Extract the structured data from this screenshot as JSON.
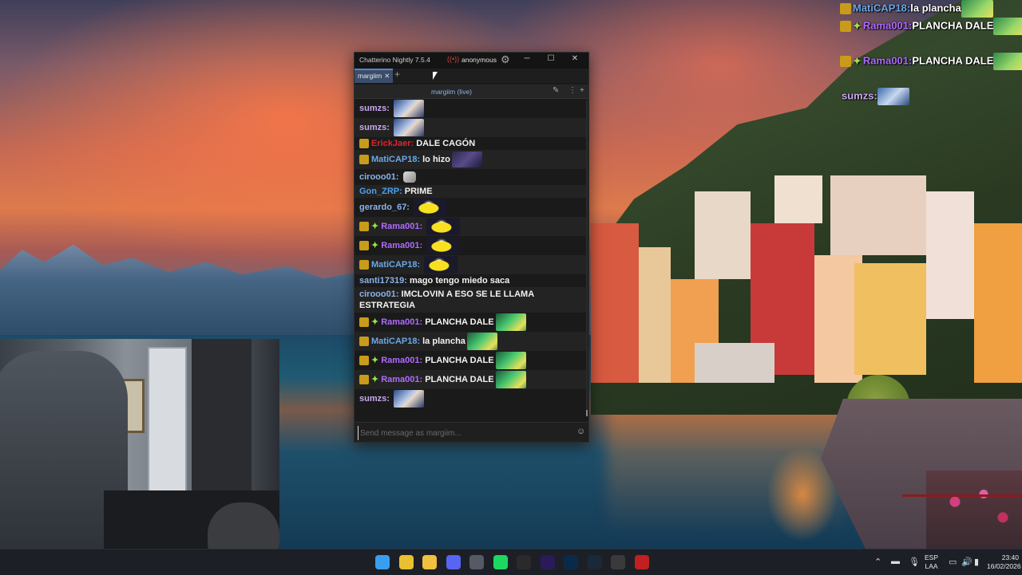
{
  "window": {
    "title": "Chatterino Nightly 7.5.4",
    "user": "anonymous",
    "minimize": "─",
    "maximize": "☐",
    "close": "✕"
  },
  "tabs": [
    {
      "label": "margiim"
    }
  ],
  "channel_header": "margiim (live)",
  "messages": [
    {
      "nick": "sumzs:",
      "color": "#c8a8f0",
      "text": "",
      "emote": "e-face"
    },
    {
      "nick": "sumzs:",
      "color": "#c8a8f0",
      "text": "",
      "emote": "e-face"
    },
    {
      "nick": "ErickJaer:",
      "color": "#e0242e",
      "text": "DALE CAGÓN",
      "badge": true
    },
    {
      "nick": "MatiCAP18:",
      "color": "#6aa8e8",
      "text": "lo hizo",
      "badge": true,
      "emote": "e-lo"
    },
    {
      "nick": "cirooo01:",
      "color": "#8ab4e8",
      "text": "",
      "emote": "e-hands"
    },
    {
      "nick": "Gon_ZRP:",
      "color": "#4aa0f0",
      "text": "PRIME"
    },
    {
      "nick": "gerardo_67:",
      "color": "#8ab4e8",
      "text": "",
      "emote": "e-minion"
    },
    {
      "nick": "Rama001:",
      "color": "#b06aff",
      "text": "",
      "badge": true,
      "spark": true,
      "emote": "e-minion"
    },
    {
      "nick": "Rama001:",
      "color": "#b06aff",
      "text": "",
      "badge": true,
      "spark": true,
      "emote": "e-minion"
    },
    {
      "nick": "MatiCAP18:",
      "color": "#6aa8e8",
      "text": "",
      "badge": true,
      "emote": "e-minion"
    },
    {
      "nick": "santi17319:",
      "color": "#8ab4e8",
      "text": "mago tengo miedo saca"
    },
    {
      "nick": "cirooo01:",
      "color": "#8ab4e8",
      "text": "IMCLOVIN A ESO SE LE LLAMA ESTRATEGIA"
    },
    {
      "nick": "Rama001:",
      "color": "#b06aff",
      "text": "PLANCHA DALE",
      "badge": true,
      "spark": true,
      "emote": "e-green"
    },
    {
      "nick": "MatiCAP18:",
      "color": "#6aa8e8",
      "text": "la plancha",
      "badge": true,
      "emote": "e-green"
    },
    {
      "nick": "Rama001:",
      "color": "#b06aff",
      "text": "PLANCHA DALE",
      "badge": true,
      "spark": true,
      "emote": "e-green"
    },
    {
      "nick": "Rama001:",
      "color": "#b06aff",
      "text": "PLANCHA DALE",
      "badge": true,
      "spark": true,
      "emote": "e-green"
    },
    {
      "nick": "sumzs:",
      "color": "#c8a8f0",
      "text": "",
      "emote": "e-face"
    }
  ],
  "input": {
    "placeholder": "Send message as margiim..."
  },
  "overlay": [
    {
      "nick": "MatiCAP18:",
      "color": "#6aa8e8",
      "text": "la plancha",
      "spark": false,
      "emote": "green"
    },
    {
      "nick": "Rama001:",
      "color": "#b06aff",
      "text": "PLANCHA DALE",
      "spark": true,
      "emote": "green"
    },
    {
      "nick": "Rama001:",
      "color": "#b06aff",
      "text": "PLANCHA DALE",
      "spark": true,
      "emote": "green"
    },
    {
      "nick": "sumzs:",
      "color": "#c8a8f0",
      "text": "",
      "spark": false,
      "emote": "face",
      "nobadge": true
    }
  ],
  "taskbar": {
    "language_top": "ESP",
    "language_bottom": "LAA",
    "time": "23:40",
    "date": "16/02/2026",
    "apps": [
      {
        "name": "windows-start-icon",
        "color": "#3a9ef0"
      },
      {
        "name": "chrome-icon",
        "color": "#e8c030"
      },
      {
        "name": "file-explorer-icon",
        "color": "#f0c040"
      },
      {
        "name": "discord-icon",
        "color": "#5865f2"
      },
      {
        "name": "obs-icon",
        "color": "#555a64"
      },
      {
        "name": "spotify-icon",
        "color": "#1ed760"
      },
      {
        "name": "capcut-icon",
        "color": "#2a2a2a"
      },
      {
        "name": "premiere-icon",
        "color": "#2a1a5a"
      },
      {
        "name": "photoshop-icon",
        "color": "#0a2a4a"
      },
      {
        "name": "steam-icon",
        "color": "#1b2838"
      },
      {
        "name": "chatterino-icon",
        "color": "#3a3a3a"
      },
      {
        "name": "recorder-icon",
        "color": "#c02020"
      }
    ]
  },
  "colors": {
    "badge": "#c89b1a",
    "accent_tab": "#5b86c8",
    "channel": "#8ab4e8"
  }
}
